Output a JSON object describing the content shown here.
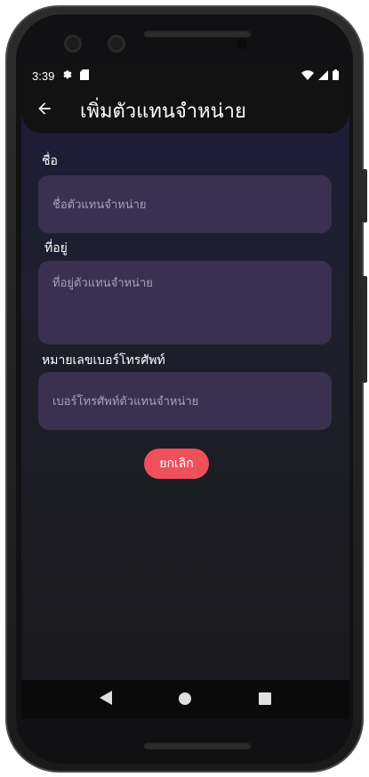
{
  "status_bar": {
    "time": "3:39"
  },
  "app_bar": {
    "title": "เพิ่มตัวแทนจำหน่าย"
  },
  "form": {
    "name": {
      "label": "ชื่อ",
      "placeholder": "ชื่อตัวแทนจำหน่าย",
      "value": ""
    },
    "address": {
      "label": "ที่อยู่",
      "placeholder": "ที่อยู่ตัวแทนจำหน่าย",
      "value": ""
    },
    "phone": {
      "label": "หมายเลขเบอร์โทรศัพท์",
      "placeholder": "เบอร์โทรศัพท์ตัวแทนจำหน่าย",
      "value": ""
    }
  },
  "actions": {
    "cancel_label": "ยกเลิก"
  },
  "icons": {
    "back": "arrow-left-icon",
    "settings": "gear-icon",
    "sd_card": "sd-card-icon",
    "wifi": "wifi-icon",
    "signal": "signal-icon",
    "battery": "battery-icon",
    "nav_back": "triangle-back-icon",
    "nav_home": "circle-home-icon",
    "nav_recents": "square-recents-icon"
  },
  "colors": {
    "accent": "#f0505a",
    "field_bg": "#3a3050",
    "app_bar_bg": "#121212"
  }
}
